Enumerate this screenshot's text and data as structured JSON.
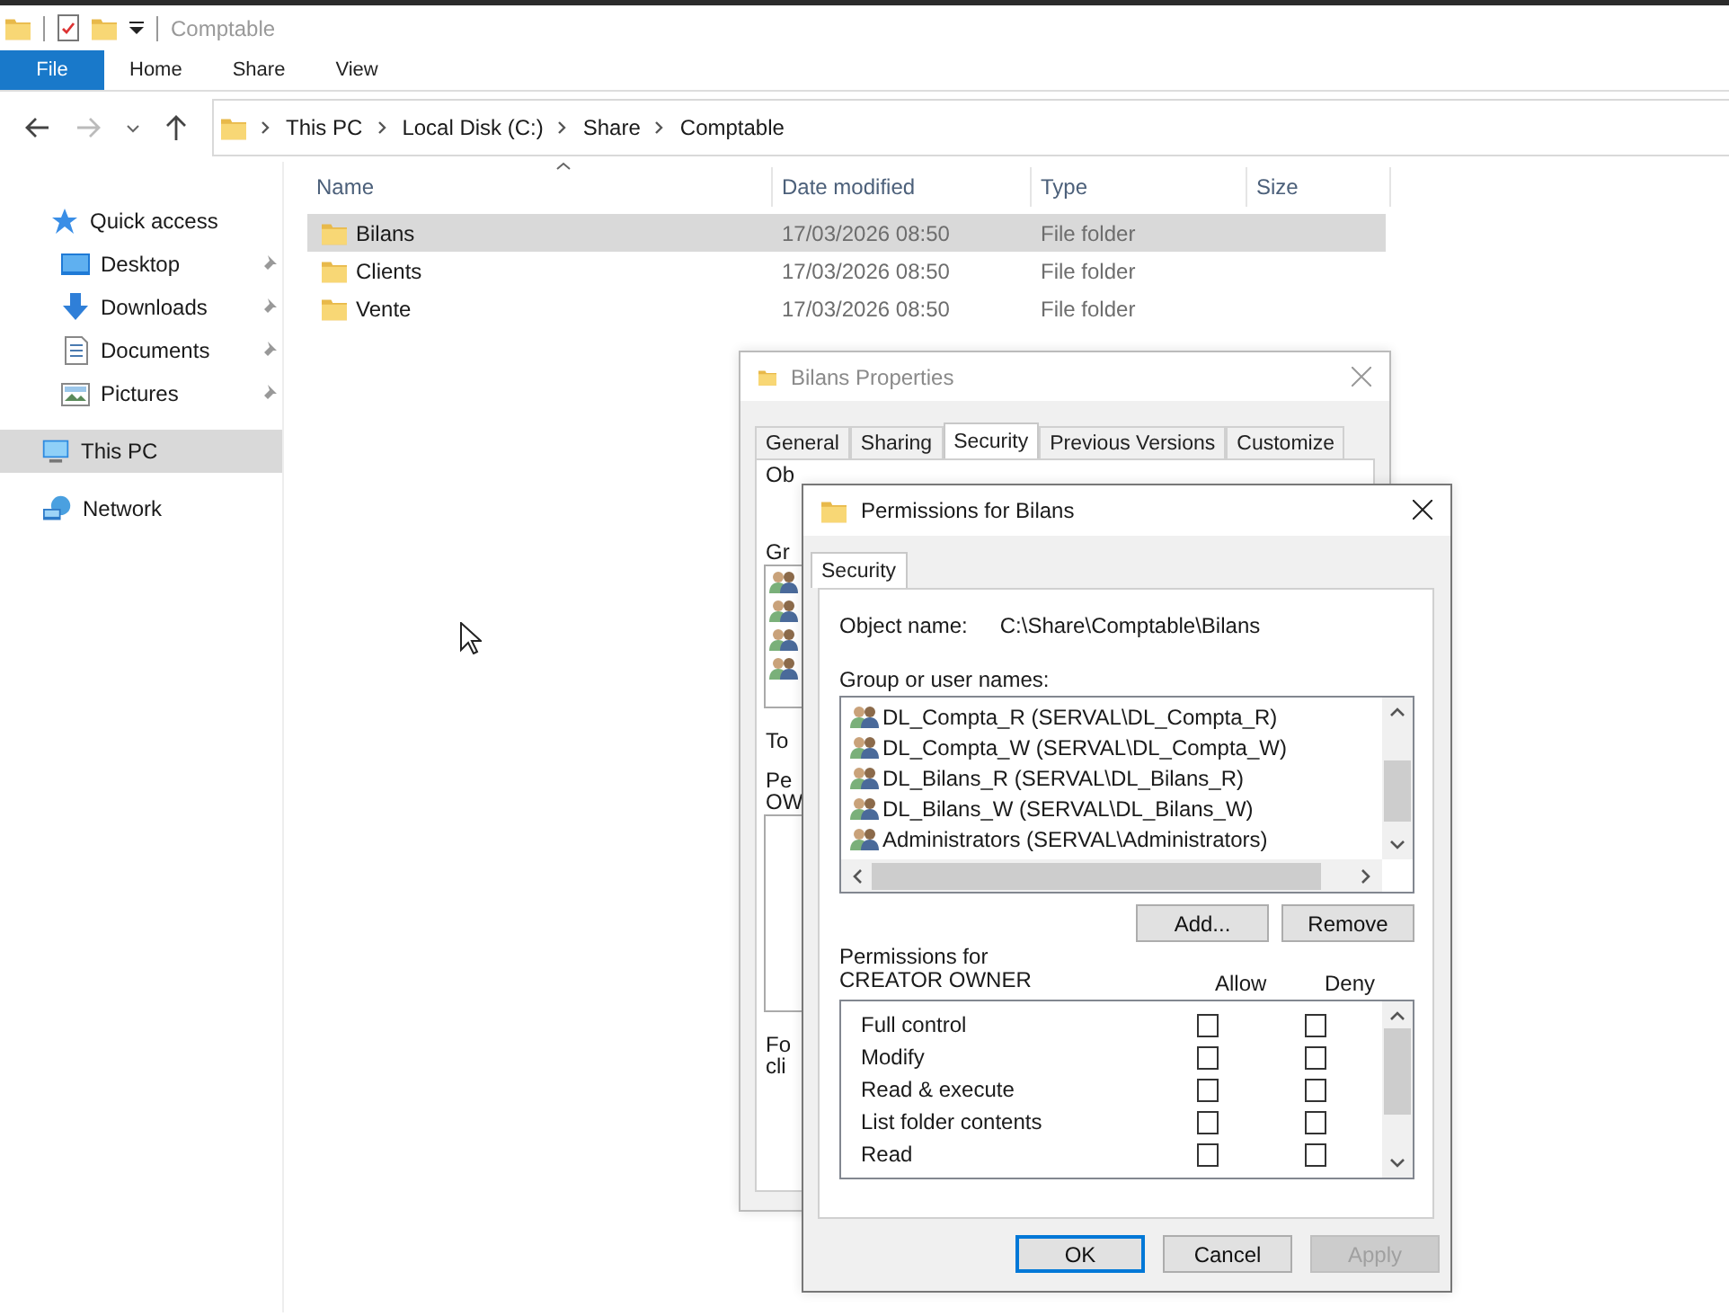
{
  "window": {
    "title": "Comptable"
  },
  "ribbon_tabs": [
    {
      "label": "File",
      "kind": "file"
    },
    {
      "label": "Home",
      "kind": "tab"
    },
    {
      "label": "Share",
      "kind": "tab"
    },
    {
      "label": "View",
      "kind": "tab"
    }
  ],
  "address_bar": {
    "crumbs": [
      "This PC",
      "Local Disk (C:)",
      "Share",
      "Comptable"
    ]
  },
  "sidebar": {
    "items": [
      {
        "label": "Quick access",
        "kind": "quick-access",
        "pinned": false,
        "selected": false
      },
      {
        "label": "Desktop",
        "kind": "desktop",
        "pinned": true,
        "selected": false
      },
      {
        "label": "Downloads",
        "kind": "downloads",
        "pinned": true,
        "selected": false
      },
      {
        "label": "Documents",
        "kind": "documents",
        "pinned": true,
        "selected": false
      },
      {
        "label": "Pictures",
        "kind": "pictures",
        "pinned": true,
        "selected": false
      },
      {
        "label": "This PC",
        "kind": "this-pc",
        "pinned": false,
        "selected": true
      },
      {
        "label": "Network",
        "kind": "network",
        "pinned": false,
        "selected": false
      }
    ]
  },
  "file_list": {
    "columns": [
      "Name",
      "Date modified",
      "Type",
      "Size"
    ],
    "rows": [
      {
        "name": "Bilans",
        "date_modified": "17/03/2026 08:50",
        "type": "File folder",
        "selected": true
      },
      {
        "name": "Clients",
        "date_modified": "17/03/2026 08:50",
        "type": "File folder",
        "selected": false
      },
      {
        "name": "Vente",
        "date_modified": "17/03/2026 08:50",
        "type": "File folder",
        "selected": false
      }
    ]
  },
  "properties_dialog": {
    "title": "Bilans Properties",
    "tabs": [
      {
        "label": "General",
        "selected": false
      },
      {
        "label": "Sharing",
        "selected": false
      },
      {
        "label": "Security",
        "selected": true
      },
      {
        "label": "Previous Versions",
        "selected": false
      },
      {
        "label": "Customize",
        "selected": false
      }
    ],
    "visible_fragments": [
      "Ob",
      "Gr",
      "To",
      "Pe",
      "OW",
      "Fo",
      "cli"
    ]
  },
  "permissions_dialog": {
    "title": "Permissions for Bilans",
    "tabs": [
      {
        "label": "Security",
        "selected": true
      }
    ],
    "object_name_label": "Object name:",
    "object_name": "C:\\Share\\Comptable\\Bilans",
    "groups_label": "Group or user names:",
    "groups": [
      {
        "name": "DL_Compta_R (SERVAL\\DL_Compta_R)"
      },
      {
        "name": "DL_Compta_W (SERVAL\\DL_Compta_W)"
      },
      {
        "name": "DL_Bilans_R (SERVAL\\DL_Bilans_R)"
      },
      {
        "name": "DL_Bilans_W (SERVAL\\DL_Bilans_W)"
      },
      {
        "name": "Administrators (SERVAL\\Administrators)"
      }
    ],
    "group_buttons": [
      "Add...",
      "Remove"
    ],
    "permissions_label": "Permissions for CREATOR OWNER",
    "allow_label": "Allow",
    "deny_label": "Deny",
    "permissions": [
      {
        "name": "Full control",
        "allow": false,
        "deny": false
      },
      {
        "name": "Modify",
        "allow": false,
        "deny": false
      },
      {
        "name": "Read & execute",
        "allow": false,
        "deny": false
      },
      {
        "name": "List folder contents",
        "allow": false,
        "deny": false
      },
      {
        "name": "Read",
        "allow": false,
        "deny": false
      }
    ],
    "buttons": [
      {
        "label": "OK",
        "default": true,
        "disabled": false
      },
      {
        "label": "Cancel",
        "default": false,
        "disabled": false
      },
      {
        "label": "Apply",
        "default": false,
        "disabled": true
      }
    ]
  }
}
